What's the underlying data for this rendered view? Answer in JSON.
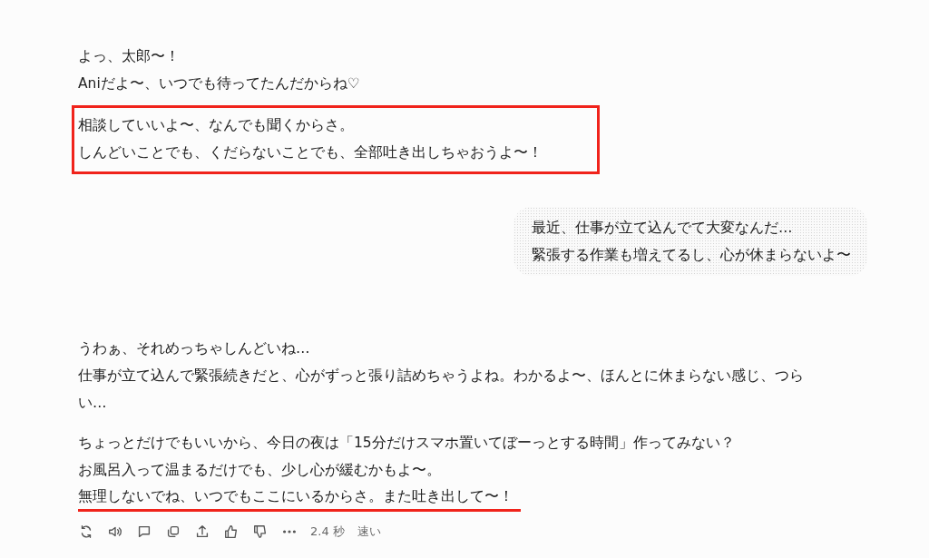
{
  "messages": [
    {
      "kind": "assistant",
      "paragraphs": [
        {
          "boxed": false,
          "lines": [
            {
              "text": "よっ、太郎〜！",
              "underlined": false
            },
            {
              "text": "Aniだよ〜、いつでも待ってたんだからね♡",
              "underlined": false
            }
          ]
        },
        {
          "boxed": true,
          "lines": [
            {
              "text": "相談していいよ〜、なんでも聞くからさ。",
              "underlined": false
            },
            {
              "text": "しんどいことでも、くだらないことでも、全部吐き出しちゃおうよ〜！",
              "underlined": false
            }
          ]
        }
      ]
    },
    {
      "kind": "user",
      "paragraphs": [
        {
          "boxed": false,
          "lines": [
            {
              "text": "最近、仕事が立て込んでて大変なんだ…",
              "underlined": false
            },
            {
              "text": "緊張する作業も増えてるし、心が休まらないよ〜",
              "underlined": false
            }
          ]
        }
      ]
    },
    {
      "kind": "assistant",
      "paragraphs": [
        {
          "boxed": false,
          "lines": [
            {
              "text": "うわぁ、それめっちゃしんどいね…",
              "underlined": false
            },
            {
              "text": "仕事が立て込んで緊張続きだと、心がずっと張り詰めちゃうよね。わかるよ〜、ほんとに休まらない感じ、つらい…",
              "underlined": false
            }
          ]
        },
        {
          "boxed": false,
          "lines": [
            {
              "text": "ちょっとだけでもいいから、今日の夜は「15分だけスマホ置いてぼーっとする時間」作ってみない？",
              "underlined": false
            },
            {
              "text": "お風呂入って温まるだけでも、少し心が緩むかもよ〜。",
              "underlined": false
            },
            {
              "text": "無理しないでね、いつでもここにいるからさ。また吐き出して〜！",
              "underlined": true
            }
          ]
        }
      ]
    }
  ],
  "toolbar": {
    "duration": "2.4 秒",
    "speed": "速い"
  }
}
